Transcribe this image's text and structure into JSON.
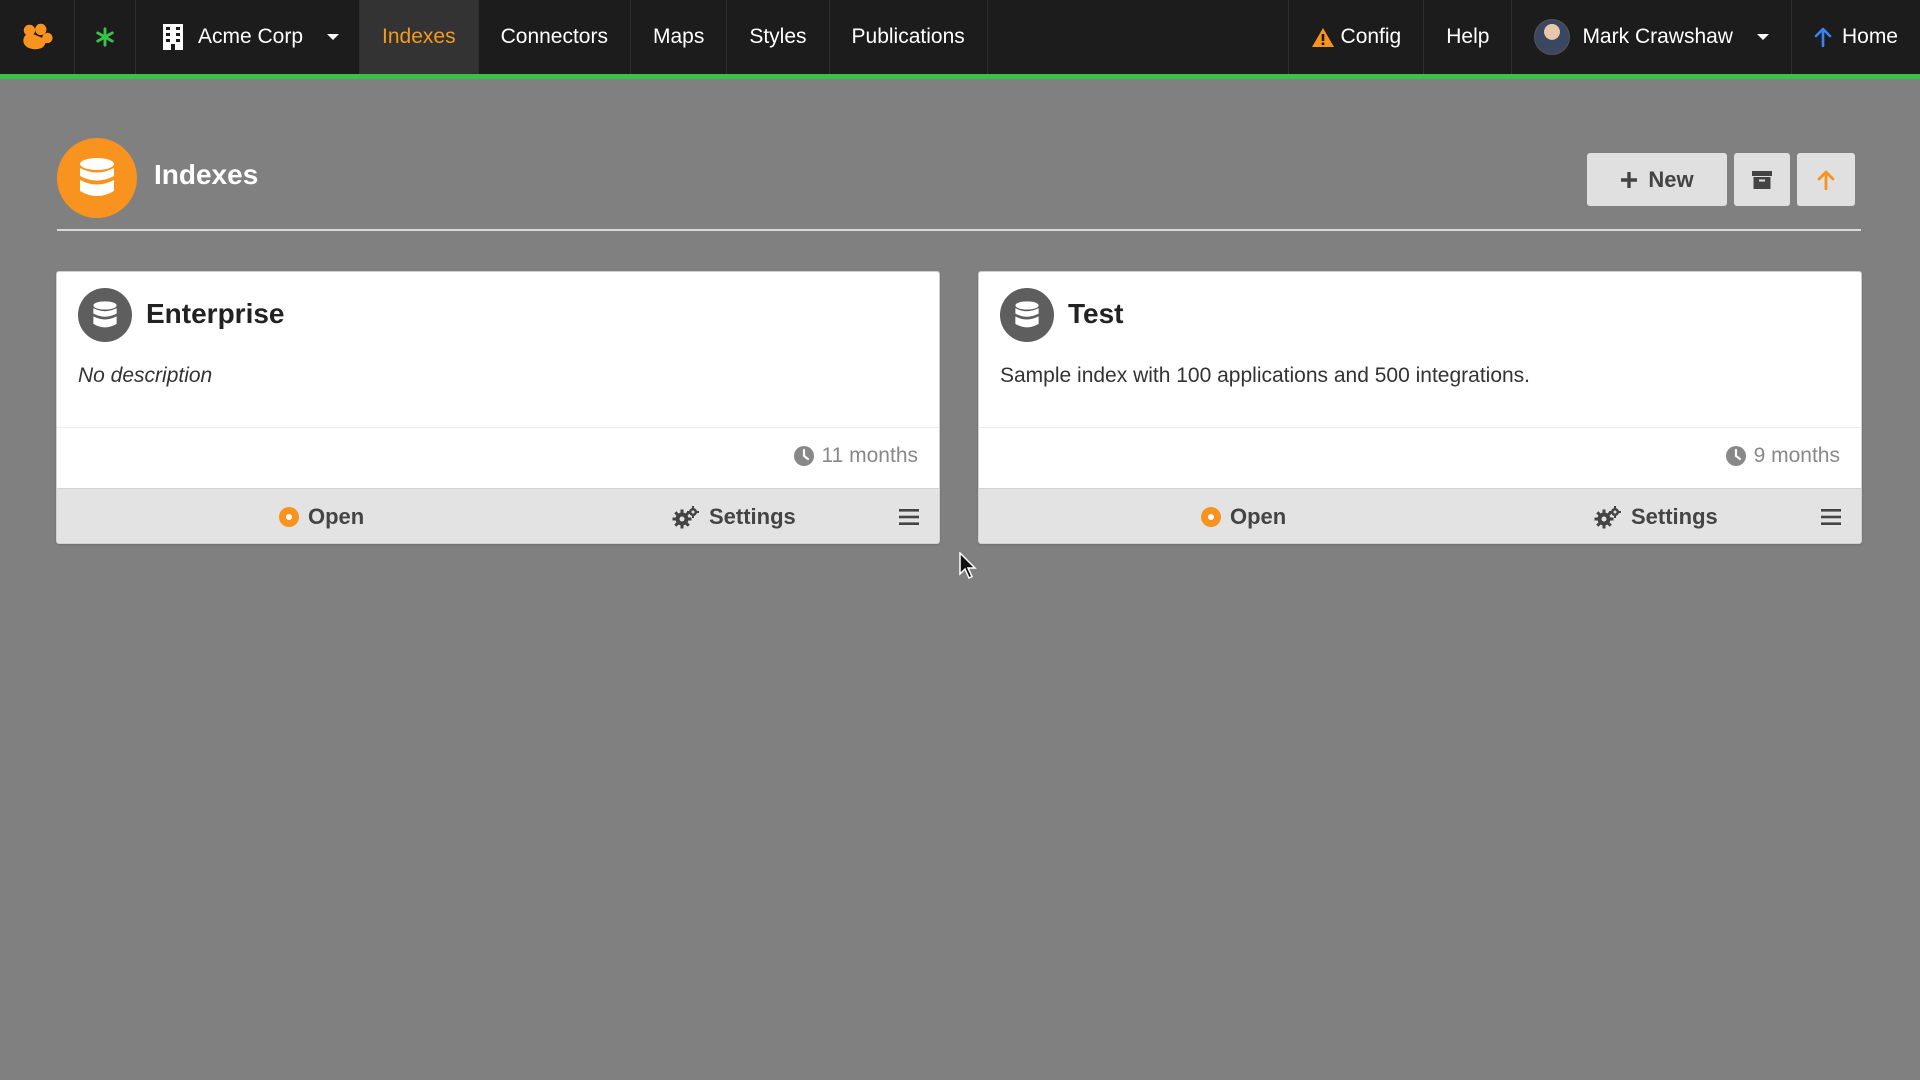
{
  "nav": {
    "org_name": "Acme Corp",
    "items": [
      {
        "label": "Indexes",
        "active": true
      },
      {
        "label": "Connectors",
        "active": false
      },
      {
        "label": "Maps",
        "active": false
      },
      {
        "label": "Styles",
        "active": false
      },
      {
        "label": "Publications",
        "active": false
      }
    ],
    "config_label": "Config",
    "help_label": "Help",
    "user_name": "Mark Crawshaw",
    "home_label": "Home"
  },
  "page": {
    "title": "Indexes",
    "new_label": "New"
  },
  "cards": [
    {
      "title": "Enterprise",
      "description": "No description",
      "age": "11 months",
      "open_label": "Open",
      "settings_label": "Settings"
    },
    {
      "title": "Test",
      "description": "Sample index with 100 applications and 500 integrations.",
      "age": "9 months",
      "open_label": "Open",
      "settings_label": "Settings"
    }
  ],
  "colors": {
    "accent": "#f7931e",
    "nav_border": "#3bc14a",
    "nav_bg": "#1c1c1c",
    "page_bg": "#808080",
    "card_icon": "#5e5e5e"
  },
  "icons": {
    "logo": "paw-logo-icon",
    "asterisk": "asterisk-icon",
    "org": "building-icon",
    "config": "warning-icon",
    "home": "arrow-up-icon",
    "page": "database-icon",
    "new": "plus-icon",
    "archive": "archive-icon",
    "upload": "arrow-up-icon",
    "time": "clock-icon",
    "settings": "gears-icon",
    "menu": "hamburger-icon"
  }
}
